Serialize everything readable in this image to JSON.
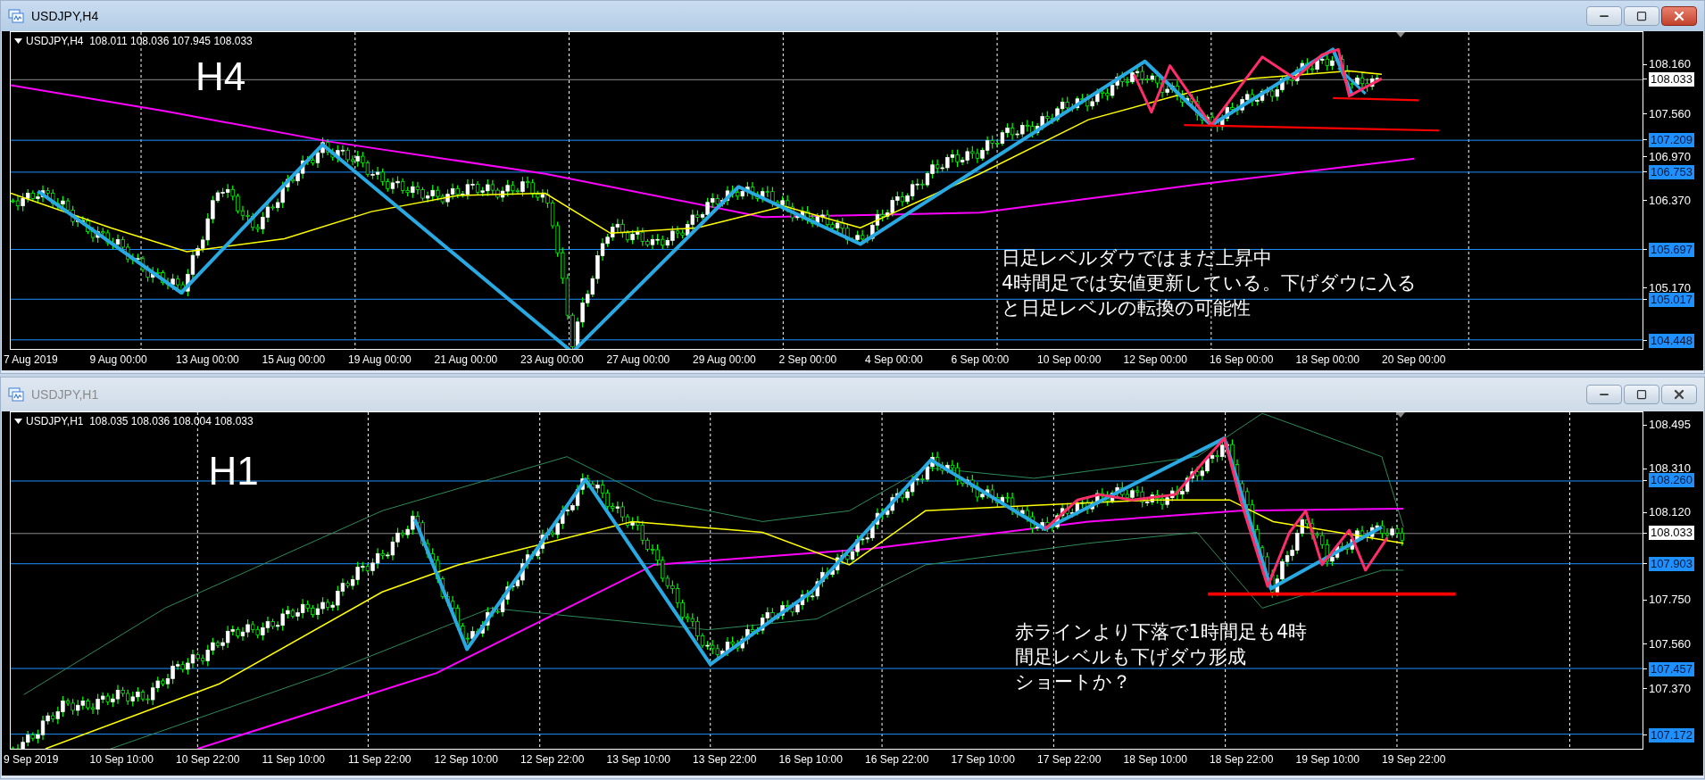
{
  "windows": [
    {
      "title": "USDJPY,H4",
      "active": true,
      "header": "USDJPY,H4  108.011 108.036 107.945 108.033",
      "timeframe_label": "H4",
      "price_labels": [
        {
          "text": "108.160",
          "kind": "tick"
        },
        {
          "text": "108.033",
          "kind": "current"
        },
        {
          "text": "107.560",
          "kind": "tick"
        },
        {
          "text": "107.209",
          "kind": "line"
        },
        {
          "text": "106.970",
          "kind": "tick"
        },
        {
          "text": "106.753",
          "kind": "line"
        },
        {
          "text": "106.370",
          "kind": "tick"
        },
        {
          "text": "105.697",
          "kind": "line"
        },
        {
          "text": "105.170",
          "kind": "tick"
        },
        {
          "text": "105.017",
          "kind": "line"
        },
        {
          "text": "104.448",
          "kind": "line"
        }
      ],
      "time_labels": [
        "7 Aug 2019",
        "9 Aug 00:00",
        "13 Aug 00:00",
        "15 Aug 00:00",
        "19 Aug 00:00",
        "21 Aug 00:00",
        "23 Aug 00:00",
        "27 Aug 00:00",
        "29 Aug 00:00",
        "2 Sep 00:00",
        "4 Sep 00:00",
        "6 Sep 00:00",
        "10 Sep 00:00",
        "12 Sep 00:00",
        "16 Sep 00:00",
        "18 Sep 00:00",
        "20 Sep 00:00"
      ],
      "notes": [
        "日足レベルダウではまだ上昇中",
        "4時間足では安値更新している。下げダウに入る",
        "と日足レベルの転換の可能性"
      ]
    },
    {
      "title": "USDJPY,H1",
      "active": false,
      "header": "USDJPY,H1  108.035 108.036 108.004 108.033",
      "timeframe_label": "H1",
      "price_labels": [
        {
          "text": "108.495",
          "kind": "tick"
        },
        {
          "text": "108.310",
          "kind": "tick"
        },
        {
          "text": "108.260",
          "kind": "line"
        },
        {
          "text": "108.120",
          "kind": "tick"
        },
        {
          "text": "108.033",
          "kind": "current"
        },
        {
          "text": "107.903",
          "kind": "line"
        },
        {
          "text": "107.750",
          "kind": "tick"
        },
        {
          "text": "107.560",
          "kind": "tick"
        },
        {
          "text": "107.457",
          "kind": "line"
        },
        {
          "text": "107.370",
          "kind": "tick"
        },
        {
          "text": "107.172",
          "kind": "line"
        }
      ],
      "time_labels": [
        "9 Sep 2019",
        "10 Sep 10:00",
        "10 Sep 22:00",
        "11 Sep 10:00",
        "11 Sep 22:00",
        "12 Sep 10:00",
        "12 Sep 22:00",
        "13 Sep 10:00",
        "13 Sep 22:00",
        "16 Sep 10:00",
        "16 Sep 22:00",
        "17 Sep 10:00",
        "17 Sep 22:00",
        "18 Sep 10:00",
        "18 Sep 22:00",
        "19 Sep 10:00",
        "19 Sep 22:00"
      ],
      "notes": [
        "赤ラインより下落で1時間足も4時",
        "間足レベルも下げダウ形成",
        "ショートか？"
      ]
    }
  ]
}
